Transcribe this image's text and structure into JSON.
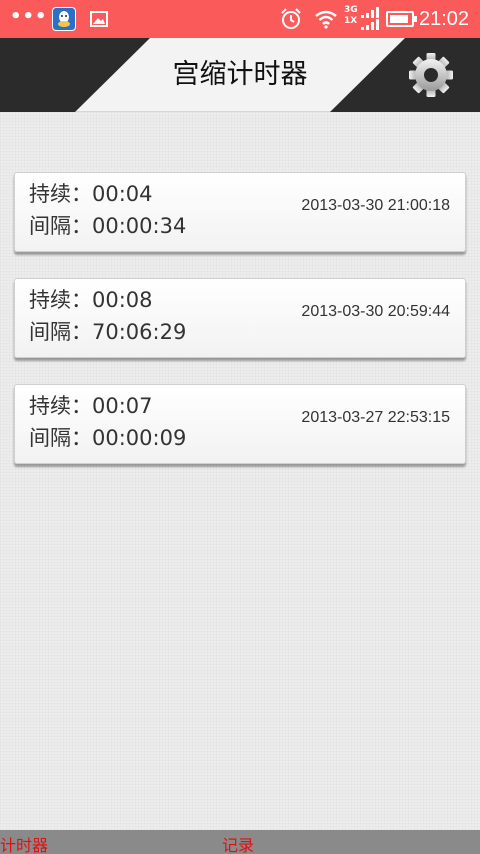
{
  "status_bar": {
    "dots": "•••",
    "network": "3G",
    "network_sub": "1X",
    "time": "21:02"
  },
  "header": {
    "title": "宫缩计时器",
    "settings_icon": "gear-icon"
  },
  "records": [
    {
      "duration_label": "持续：",
      "duration": "00:04",
      "interval_label": "间隔：",
      "interval": "00:00:34",
      "date": "2013-03-30 21:00:18"
    },
    {
      "duration_label": "持续：",
      "duration": "00:08",
      "interval_label": "间隔：",
      "interval": "70:06:29",
      "date": "2013-03-30 20:59:44"
    },
    {
      "duration_label": "持续：",
      "duration": "00:07",
      "interval_label": "间隔：",
      "interval": "00:00:09",
      "date": "2013-03-27 22:53:15"
    }
  ],
  "tabs": [
    {
      "label": "计时器"
    },
    {
      "label": "记录"
    }
  ],
  "colors": {
    "status_bar": "#fb5a5a",
    "header_dark": "#2b2b2b",
    "tab_text": "#e01010"
  }
}
